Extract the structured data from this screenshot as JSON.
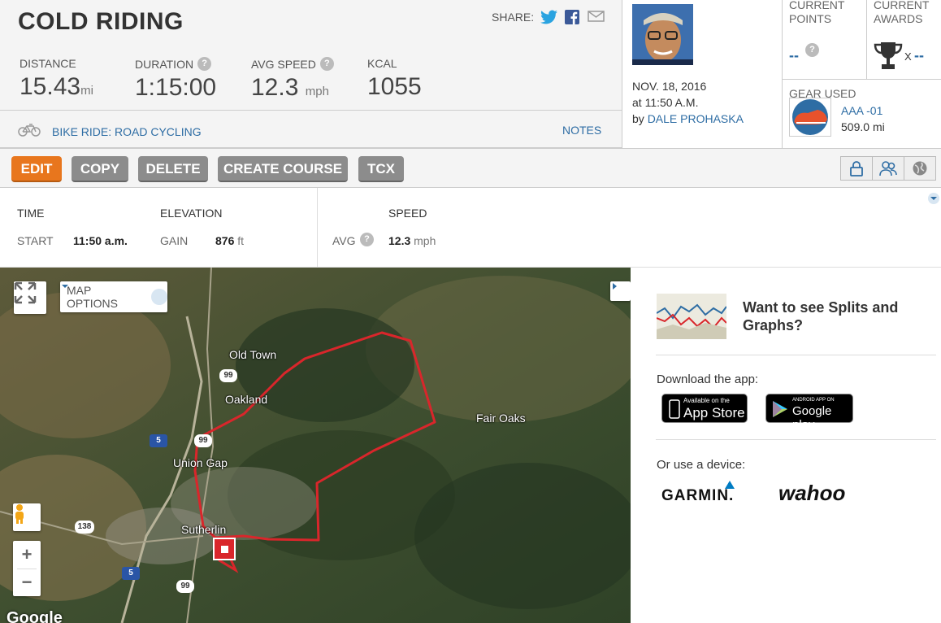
{
  "header": {
    "title": "COLD RIDING",
    "share_label": "SHARE:",
    "stats": [
      {
        "label": "DISTANCE",
        "value": "15.43",
        "unit": "mi"
      },
      {
        "label": "DURATION",
        "value": "1:15:00",
        "unit": ""
      },
      {
        "label": "AVG SPEED",
        "value": "12.3",
        "unit": "mph"
      },
      {
        "label": "KCAL",
        "value": "1055",
        "unit": ""
      }
    ],
    "ride_type": "BIKE RIDE: ROAD CYCLING",
    "notes": "NOTES",
    "help": "?"
  },
  "profile": {
    "date": "NOV. 18, 2016",
    "time": "at 11:50 A.M.",
    "by": "by",
    "name": "DALE PROHASKA"
  },
  "points": {
    "label1": "CURRENT",
    "label2": "POINTS",
    "value": "--"
  },
  "awards": {
    "label1": "CURRENT",
    "label2": "AWARDS",
    "x": "X",
    "value": "--"
  },
  "gear": {
    "label": "GEAR USED",
    "name": "AAA -01",
    "distance": "509.0",
    "unit": "mi"
  },
  "toolbar": {
    "edit": "EDIT",
    "copy": "COPY",
    "delete": "DELETE",
    "create_course": "CREATE COURSE",
    "tcx": "TCX"
  },
  "details": {
    "time_header": "TIME",
    "start_label": "START",
    "start_value": "11:50 a.m.",
    "elevation_header": "ELEVATION",
    "gain_label": "GAIN",
    "gain_value": "876",
    "gain_unit": "ft",
    "speed_header": "SPEED",
    "avg_label": "AVG",
    "avg_value": "12.3",
    "avg_unit": "mph"
  },
  "map": {
    "options_label": "MAP OPTIONS",
    "places": [
      "Old Town",
      "Oakland",
      "Union Gap",
      "Sutherlin",
      "Fair Oaks"
    ],
    "shields": [
      "99",
      "5",
      "99",
      "138",
      "5",
      "99"
    ],
    "zoom_in": "+",
    "zoom_out": "−",
    "google": "Google"
  },
  "side": {
    "splits_text": "Want to see Splits and Graphs?",
    "download": "Download the app:",
    "appstore_small": "Available on the",
    "appstore_big": "App Store",
    "googleplay_small": "ANDROID APP ON",
    "googleplay_big": "Google play",
    "device": "Or use a device:",
    "garmin": "GARMIN.",
    "wahoo": "wahoo"
  },
  "colors": {
    "accent": "#e8761d",
    "link": "#2e6da4",
    "route": "#d9262b"
  }
}
